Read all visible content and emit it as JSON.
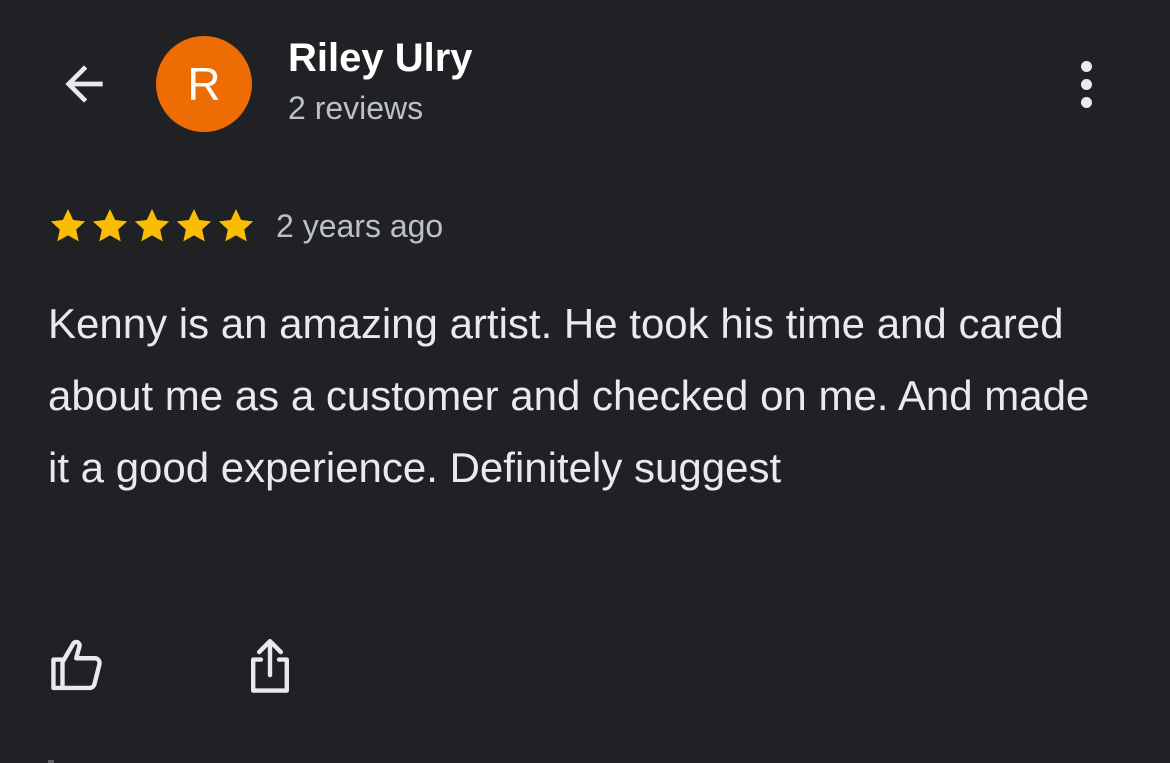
{
  "header": {
    "back_icon": "arrow-left-icon",
    "avatar_letter": "R",
    "avatar_color": "#ee6c04",
    "reviewer_name": "Riley Ulry",
    "review_count": "2 reviews",
    "more_icon": "more-vert-icon"
  },
  "review": {
    "rating": 5,
    "max_rating": 5,
    "star_color": "#fbbc04",
    "date": "2 years ago",
    "text": "Kenny is an amazing artist. He took his time and cared about me as a customer and checked on me. And made it a good experience. Definitely suggest"
  },
  "actions": {
    "like_icon": "thumb-up-icon",
    "share_icon": "share-icon"
  },
  "colors": {
    "background": "#202124",
    "primary_text": "#e8eaed",
    "secondary_text": "#bdc1c6"
  }
}
